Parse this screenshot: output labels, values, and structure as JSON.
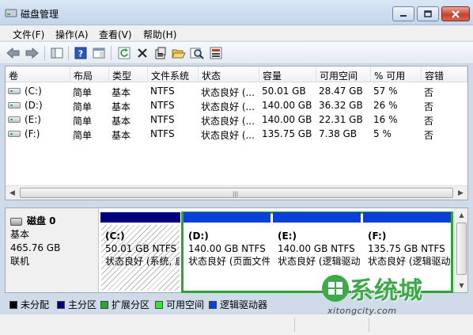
{
  "window": {
    "title": "磁盘管理"
  },
  "menu": [
    "文件(F)",
    "操作(A)",
    "查看(V)",
    "帮助(H)"
  ],
  "toolbar": [
    "back-icon",
    "forward-icon",
    "show-hide-tree-icon",
    "help-icon",
    "properties-pane-icon",
    "refresh-icon",
    "delete-icon",
    "properties-icon",
    "open-icon",
    "explore-icon",
    "rescan-icon"
  ],
  "volumes": {
    "columns": [
      "卷",
      "布局",
      "类型",
      "文件系统",
      "状态",
      "容量",
      "可用空间",
      "% 可用",
      "容错"
    ],
    "rows": [
      [
        "(C:)",
        "简单",
        "基本",
        "NTFS",
        "状态良好 (...",
        "50.01 GB",
        "28.47 GB",
        "57 %",
        "否"
      ],
      [
        "(D:)",
        "简单",
        "基本",
        "NTFS",
        "状态良好 (...",
        "140.00 GB",
        "36.32 GB",
        "26 %",
        "否"
      ],
      [
        "(E:)",
        "简单",
        "基本",
        "NTFS",
        "状态良好 (...",
        "140.00 GB",
        "22.31 GB",
        "16 %",
        "否"
      ],
      [
        "(F:)",
        "简单",
        "基本",
        "NTFS",
        "状态良好 (...",
        "135.75 GB",
        "7.38 GB",
        "5 %",
        "否"
      ]
    ]
  },
  "disk": {
    "name": "磁盘 0",
    "type": "基本",
    "size": "465.76 GB",
    "status": "联机",
    "partitions": [
      {
        "name": "(C:)",
        "size": "50.01 GB NTFS",
        "status": "状态良好 (系统, 启",
        "bar_color": "#00007f"
      },
      {
        "name": "(D:)",
        "size": "140.00 GB NTFS",
        "status": "状态良好 (页面文件",
        "bar_color": "#0a3fd8"
      },
      {
        "name": "(E:)",
        "size": "140.00 GB NTFS",
        "status": "状态良好 (逻辑驱动",
        "bar_color": "#0a3fd8"
      },
      {
        "name": "(F:)",
        "size": "135.75 GB NTFS",
        "status": "状态良好 (逻辑驱动",
        "bar_color": "#0a3fd8"
      }
    ]
  },
  "legend": [
    {
      "label": "未分配",
      "color": "#000000"
    },
    {
      "label": "主分区",
      "color": "#00007f"
    },
    {
      "label": "扩展分区",
      "color": "#2fa436"
    },
    {
      "label": "可用空间",
      "color": "#32e632"
    },
    {
      "label": "逻辑驱动器",
      "color": "#0a3fd8"
    }
  ],
  "watermark": {
    "text": "系统城",
    "url": "xitongcity.com"
  },
  "colors": {
    "extended_frame": "#2fa436",
    "primary": "#00007f",
    "logical": "#0a3fd8"
  }
}
